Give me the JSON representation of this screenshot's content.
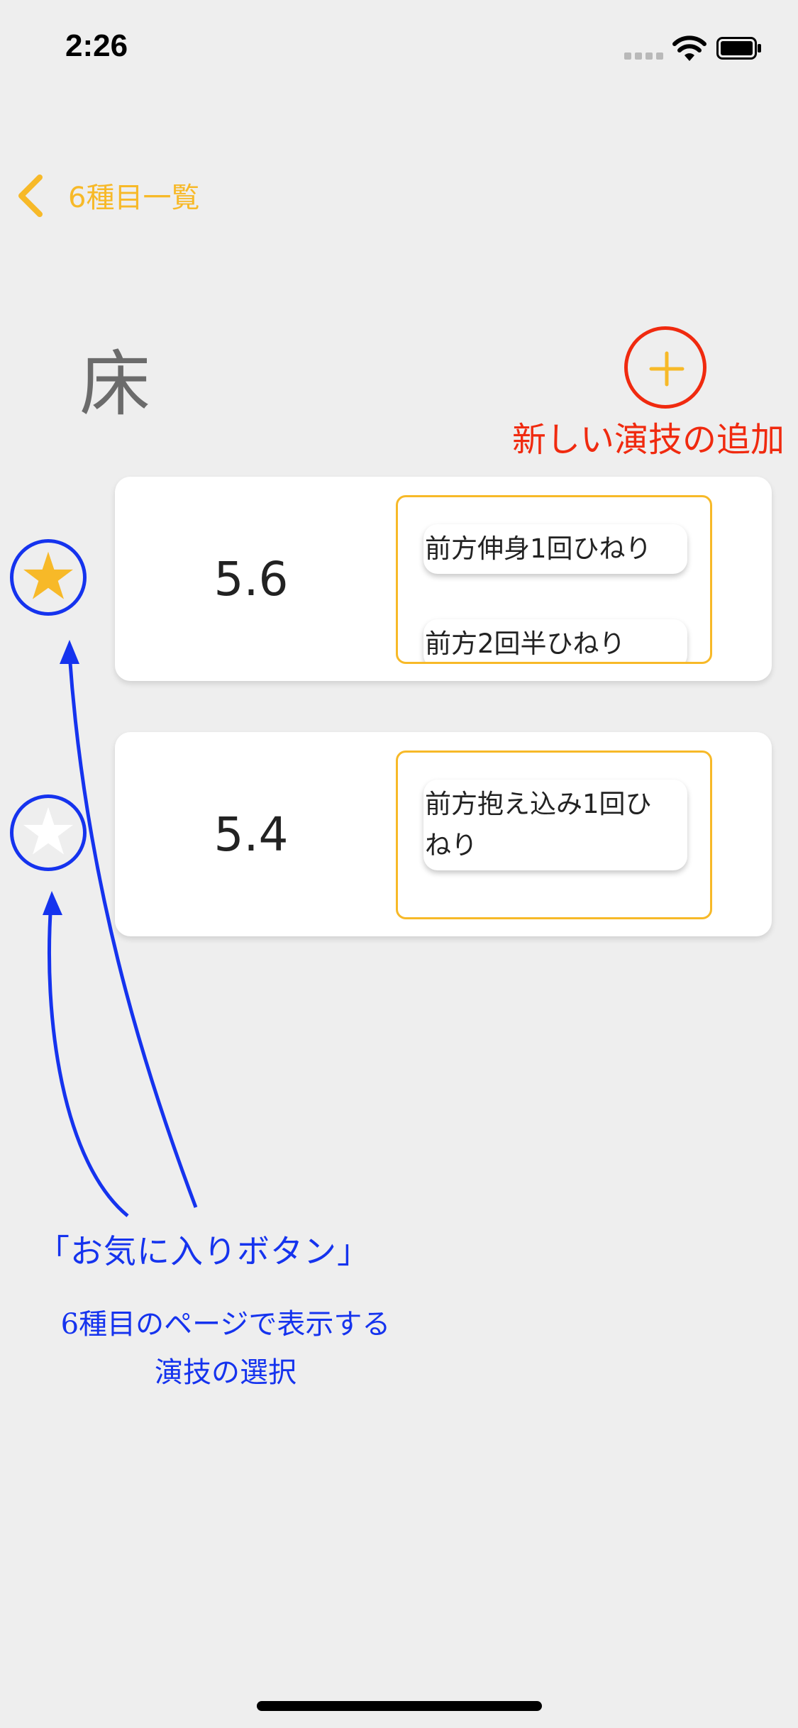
{
  "status_bar": {
    "time": "2:26"
  },
  "nav": {
    "back_label": "6種目一覧"
  },
  "page": {
    "title": "床"
  },
  "add_button": {
    "caption": "新しい演技の追加"
  },
  "routines": [
    {
      "score": "5.6",
      "favorite": true,
      "skills": [
        "前方伸身1回ひねり",
        "前方2回半ひねり"
      ]
    },
    {
      "score": "5.4",
      "favorite": false,
      "skills": [
        "前方抱え込み1回ひ\nねり"
      ]
    }
  ],
  "annotation": {
    "title": "「お気に入りボタン」",
    "line1": "6種目のページで表示する",
    "line2": "演技の選択"
  },
  "colors": {
    "accent": "#f7b928",
    "annotation_red": "#f02a0f",
    "annotation_blue": "#1533ee",
    "background": "#eeeeee"
  }
}
